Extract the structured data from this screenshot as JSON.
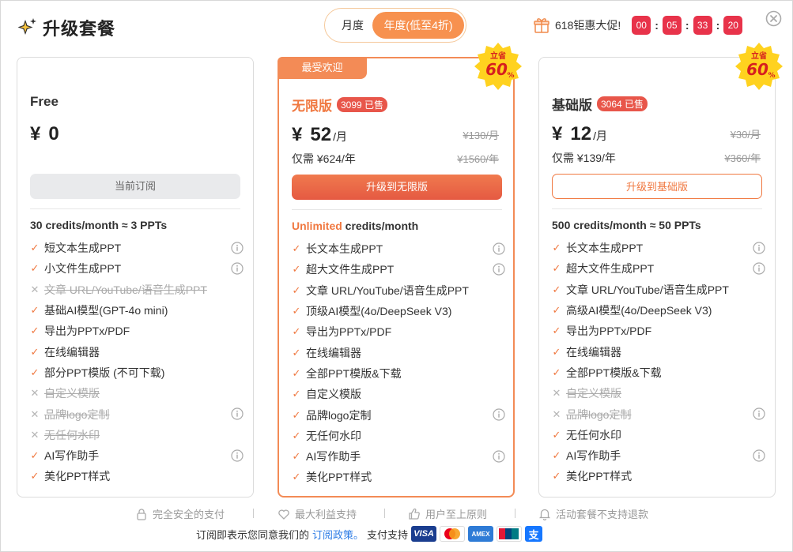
{
  "header": {
    "title": "升级套餐",
    "billing": {
      "monthly_label": "月度",
      "yearly_label": "年度(低至4折)"
    },
    "promo_text": "618钜惠大促!",
    "countdown": [
      "00",
      "05",
      "33",
      "20"
    ]
  },
  "badge": {
    "top": "立省",
    "value": "60",
    "pct": "%"
  },
  "plans": {
    "free": {
      "name": "Free",
      "currency": "¥",
      "price": "0",
      "cta": "当前订阅",
      "credits": "30 credits/month ≈ 3 PPTs",
      "features": [
        {
          "label": "短文本生成PPT",
          "on": true,
          "info": true
        },
        {
          "label": "小文件生成PPT",
          "on": true,
          "info": true
        },
        {
          "label": "文章 URL/YouTube/语音生成PPT",
          "on": false,
          "info": false
        },
        {
          "label": "基础AI模型(GPT-4o mini)",
          "on": true,
          "info": false
        },
        {
          "label": "导出为PPTx/PDF",
          "on": true,
          "info": false
        },
        {
          "label": "在线编辑器",
          "on": true,
          "info": false
        },
        {
          "label": "部分PPT模版 (不可下载)",
          "on": true,
          "info": false
        },
        {
          "label": "自定义模版",
          "on": false,
          "info": false
        },
        {
          "label": "品牌logo定制",
          "on": false,
          "info": true
        },
        {
          "label": "无任何水印",
          "on": false,
          "info": false
        },
        {
          "label": "AI写作助手",
          "on": true,
          "info": true
        },
        {
          "label": "美化PPT样式",
          "on": true,
          "info": false
        }
      ]
    },
    "unlimited": {
      "tag": "最受欢迎",
      "name": "无限版",
      "sold": "3099 已售",
      "currency": "¥",
      "price": "52",
      "unit": "/月",
      "orig_price": "¥130/月",
      "yearly": "仅需 ¥624/年",
      "orig_yearly": "¥1560/年",
      "cta": "升级到无限版",
      "credits_hl": "Unlimited",
      "credits_rest": " credits/month",
      "features": [
        {
          "label": "长文本生成PPT",
          "on": true,
          "info": true
        },
        {
          "label": "超大文件生成PPT",
          "on": true,
          "info": true
        },
        {
          "label": "文章 URL/YouTube/语音生成PPT",
          "on": true,
          "info": false
        },
        {
          "label": "顶级AI模型(4o/DeepSeek V3)",
          "on": true,
          "info": false
        },
        {
          "label": "导出为PPTx/PDF",
          "on": true,
          "info": false
        },
        {
          "label": "在线编辑器",
          "on": true,
          "info": false
        },
        {
          "label": "全部PPT模版&下载",
          "on": true,
          "info": false
        },
        {
          "label": "自定义模版",
          "on": true,
          "info": false
        },
        {
          "label": "品牌logo定制",
          "on": true,
          "info": true
        },
        {
          "label": "无任何水印",
          "on": true,
          "info": false
        },
        {
          "label": "AI写作助手",
          "on": true,
          "info": true
        },
        {
          "label": "美化PPT样式",
          "on": true,
          "info": false
        }
      ]
    },
    "basic": {
      "name": "基础版",
      "sold": "3064 已售",
      "currency": "¥",
      "price": "12",
      "unit": "/月",
      "orig_price": "¥30/月",
      "yearly": "仅需 ¥139/年",
      "orig_yearly": "¥360/年",
      "cta": "升级到基础版",
      "credits": "500 credits/month ≈ 50 PPTs",
      "features": [
        {
          "label": "长文本生成PPT",
          "on": true,
          "info": true
        },
        {
          "label": "超大文件生成PPT",
          "on": true,
          "info": true
        },
        {
          "label": "文章 URL/YouTube/语音生成PPT",
          "on": true,
          "info": false
        },
        {
          "label": "高级AI模型(4o/DeepSeek V3)",
          "on": true,
          "info": false
        },
        {
          "label": "导出为PPTx/PDF",
          "on": true,
          "info": false
        },
        {
          "label": "在线编辑器",
          "on": true,
          "info": false
        },
        {
          "label": "全部PPT模版&下载",
          "on": true,
          "info": false
        },
        {
          "label": "自定义模版",
          "on": false,
          "info": false
        },
        {
          "label": "品牌logo定制",
          "on": false,
          "info": true
        },
        {
          "label": "无任何水印",
          "on": true,
          "info": false
        },
        {
          "label": "AI写作助手",
          "on": true,
          "info": true
        },
        {
          "label": "美化PPT样式",
          "on": true,
          "info": false
        }
      ]
    }
  },
  "footer": {
    "guarantees": [
      "完全安全的支付",
      "最大利益支持",
      "用户至上原则",
      "活动套餐不支持退款"
    ],
    "terms_prefix": "订阅即表示您同意我们的",
    "terms_link": "订阅政策。",
    "pay_label": "支付支持",
    "payment_methods": [
      "VISA",
      "Mastercard",
      "AMEX",
      "UnionPay",
      "支付宝"
    ]
  },
  "colors": {
    "accent": "#f07840",
    "countdown": "#e8334a",
    "link": "#2c7be5"
  }
}
